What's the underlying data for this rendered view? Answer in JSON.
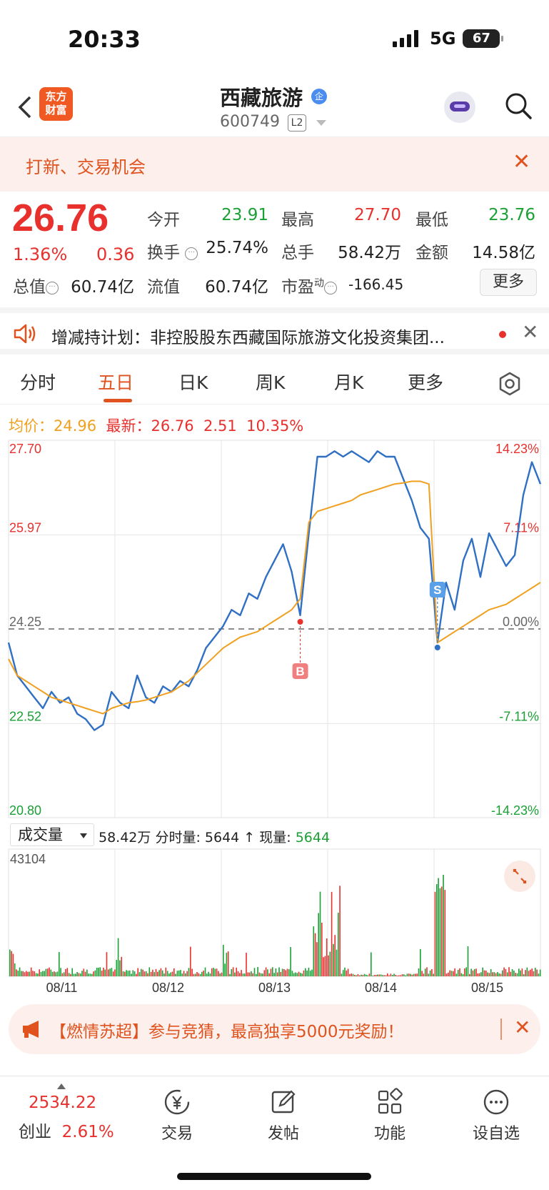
{
  "status": {
    "time": "20:33",
    "network": "5G",
    "battery": "67"
  },
  "nav": {
    "logo_text": "东方财富",
    "title": "西藏旅游",
    "title_badge": "企",
    "code": "600749",
    "level_badge": "L2"
  },
  "banner": {
    "text": "打新、交易机会"
  },
  "quote": {
    "price": "26.76",
    "pct": "1.36%",
    "change": "0.36",
    "open_label": "今开",
    "open": "23.91",
    "high_label": "最高",
    "high": "27.70",
    "low_label": "最低",
    "low": "23.76",
    "turnover_label": "换手",
    "turnover": "25.74%",
    "volume_label": "总手",
    "volume": "58.42万",
    "amount_label": "金额",
    "amount": "14.58亿",
    "mktcap_label": "总值",
    "mktcap": "60.74亿",
    "float_label": "流值",
    "float": "60.74亿",
    "pe_label": "市盈",
    "pe_sup": "动",
    "pe": "-166.45",
    "more_label": "更多"
  },
  "notice": {
    "text": "增减持计划：非控股股东西藏国际旅游文化投资集团..."
  },
  "tabs": [
    "分时",
    "五日",
    "日K",
    "周K",
    "月K",
    "更多"
  ],
  "info": {
    "avg_label": "均价：",
    "avg": "24.96",
    "latest_label": "最新：",
    "latest": "26.76",
    "chg": "2.51",
    "chg_pct": "10.35%"
  },
  "chart_data": {
    "type": "line",
    "x": [
      "08/11",
      "08/12",
      "08/13",
      "08/14",
      "08/15"
    ],
    "y_ticks_left": [
      "27.70",
      "25.97",
      "24.25",
      "22.52",
      "20.80"
    ],
    "y_ticks_right": [
      "14.23%",
      "7.11%",
      "0.00%",
      "-7.11%",
      "-14.23%"
    ],
    "ylim": [
      20.8,
      27.7
    ],
    "reference": 24.25,
    "markers": {
      "buy": "B",
      "sell": "S"
    },
    "series": [
      {
        "name": "最新",
        "color": "#2f6fc4",
        "values": [
          24.0,
          23.4,
          23.2,
          23.0,
          22.8,
          23.1,
          22.9,
          23.0,
          22.7,
          22.6,
          22.4,
          22.5,
          23.1,
          22.9,
          22.8,
          23.4,
          23.0,
          22.9,
          23.2,
          23.1,
          23.3,
          23.2,
          23.5,
          23.9,
          24.1,
          24.3,
          24.6,
          24.5,
          24.9,
          24.8,
          25.2,
          25.5,
          25.8,
          25.3,
          24.5,
          26.0,
          27.4,
          27.4,
          27.5,
          27.4,
          27.5,
          27.4,
          27.3,
          27.5,
          27.4,
          27.4,
          27.0,
          26.6,
          26.1,
          25.9,
          24.0,
          25.1,
          24.6,
          25.5,
          25.9,
          25.2,
          26.0,
          25.7,
          25.4,
          25.6,
          26.7,
          27.3,
          26.9
        ]
      },
      {
        "name": "均价",
        "color": "#f0a020",
        "values": [
          23.7,
          23.4,
          23.3,
          23.2,
          23.1,
          23.0,
          22.95,
          22.9,
          22.85,
          22.8,
          22.75,
          22.7,
          22.8,
          22.85,
          22.9,
          22.92,
          22.95,
          23.0,
          23.05,
          23.1,
          23.2,
          23.3,
          23.45,
          23.6,
          23.75,
          23.9,
          24.0,
          24.1,
          24.15,
          24.2,
          24.3,
          24.4,
          24.5,
          24.6,
          24.8,
          26.2,
          26.4,
          26.45,
          26.5,
          26.55,
          26.6,
          26.7,
          26.75,
          26.8,
          26.85,
          26.9,
          26.92,
          26.95,
          26.95,
          26.9,
          24.0,
          24.1,
          24.2,
          24.3,
          24.4,
          24.5,
          24.6,
          24.65,
          24.7,
          24.8,
          24.9,
          25.0,
          25.1
        ]
      }
    ],
    "volume": {
      "label": "成交量",
      "max_label": "43104"
    }
  },
  "volume_info": {
    "total": "58.42万",
    "period_label": "分时量:",
    "period": "5644",
    "now_label": "现量:",
    "now": "5644"
  },
  "promo": {
    "text": "【燃情苏超】参与竞猜，最高独享5000元奖励！"
  },
  "bottom": {
    "index_value": "2534.22",
    "index_name": "创业",
    "index_pct": "2.61%",
    "items": [
      "交易",
      "发帖",
      "功能",
      "设自选"
    ]
  }
}
